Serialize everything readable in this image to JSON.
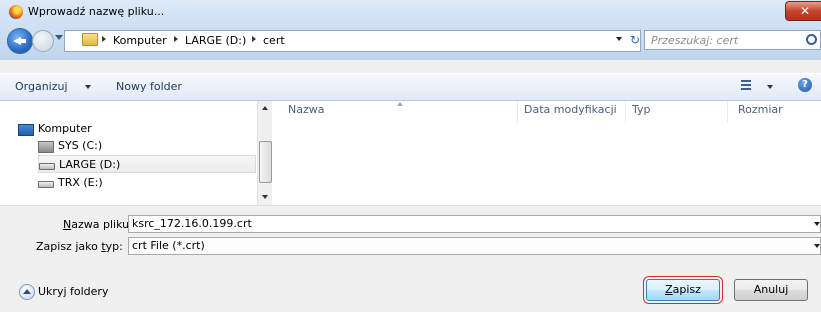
{
  "window": {
    "title": "Wprowadź nazwę pliku...",
    "close_glyph": "✕"
  },
  "address": {
    "crumbs": [
      "Komputer",
      "LARGE (D:)",
      "cert"
    ],
    "search_placeholder": "Przeszukaj: cert",
    "refresh_glyph": "↻"
  },
  "toolbar": {
    "organize": "Organizuj",
    "new_folder": "Nowy folder",
    "help": "?"
  },
  "nav": {
    "items": [
      {
        "label": "Komputer",
        "icon": "computer-icon"
      },
      {
        "label": "SYS (C:)",
        "icon": "system-drive-icon"
      },
      {
        "label": "LARGE (D:)",
        "icon": "drive-icon",
        "selected": true
      },
      {
        "label": "TRX (E:)",
        "icon": "drive-icon"
      }
    ]
  },
  "files": {
    "columns": [
      "Nazwa",
      "Data modyfikacji",
      "Typ",
      "Rozmiar"
    ]
  },
  "form": {
    "filename_label_u": "N",
    "filename_label_rest": "azwa pliku:",
    "filename_value": "ksrc_172.16.0.199.crt",
    "type_label_pre": "Zapisz jako ",
    "type_label_u": "t",
    "type_label_rest": "yp:",
    "type_value": "crt File (*.crt)"
  },
  "footer": {
    "hide_folders": "Ukryj foldery",
    "save_u": "Z",
    "save_rest": "apisz",
    "cancel": "Anuluj"
  }
}
